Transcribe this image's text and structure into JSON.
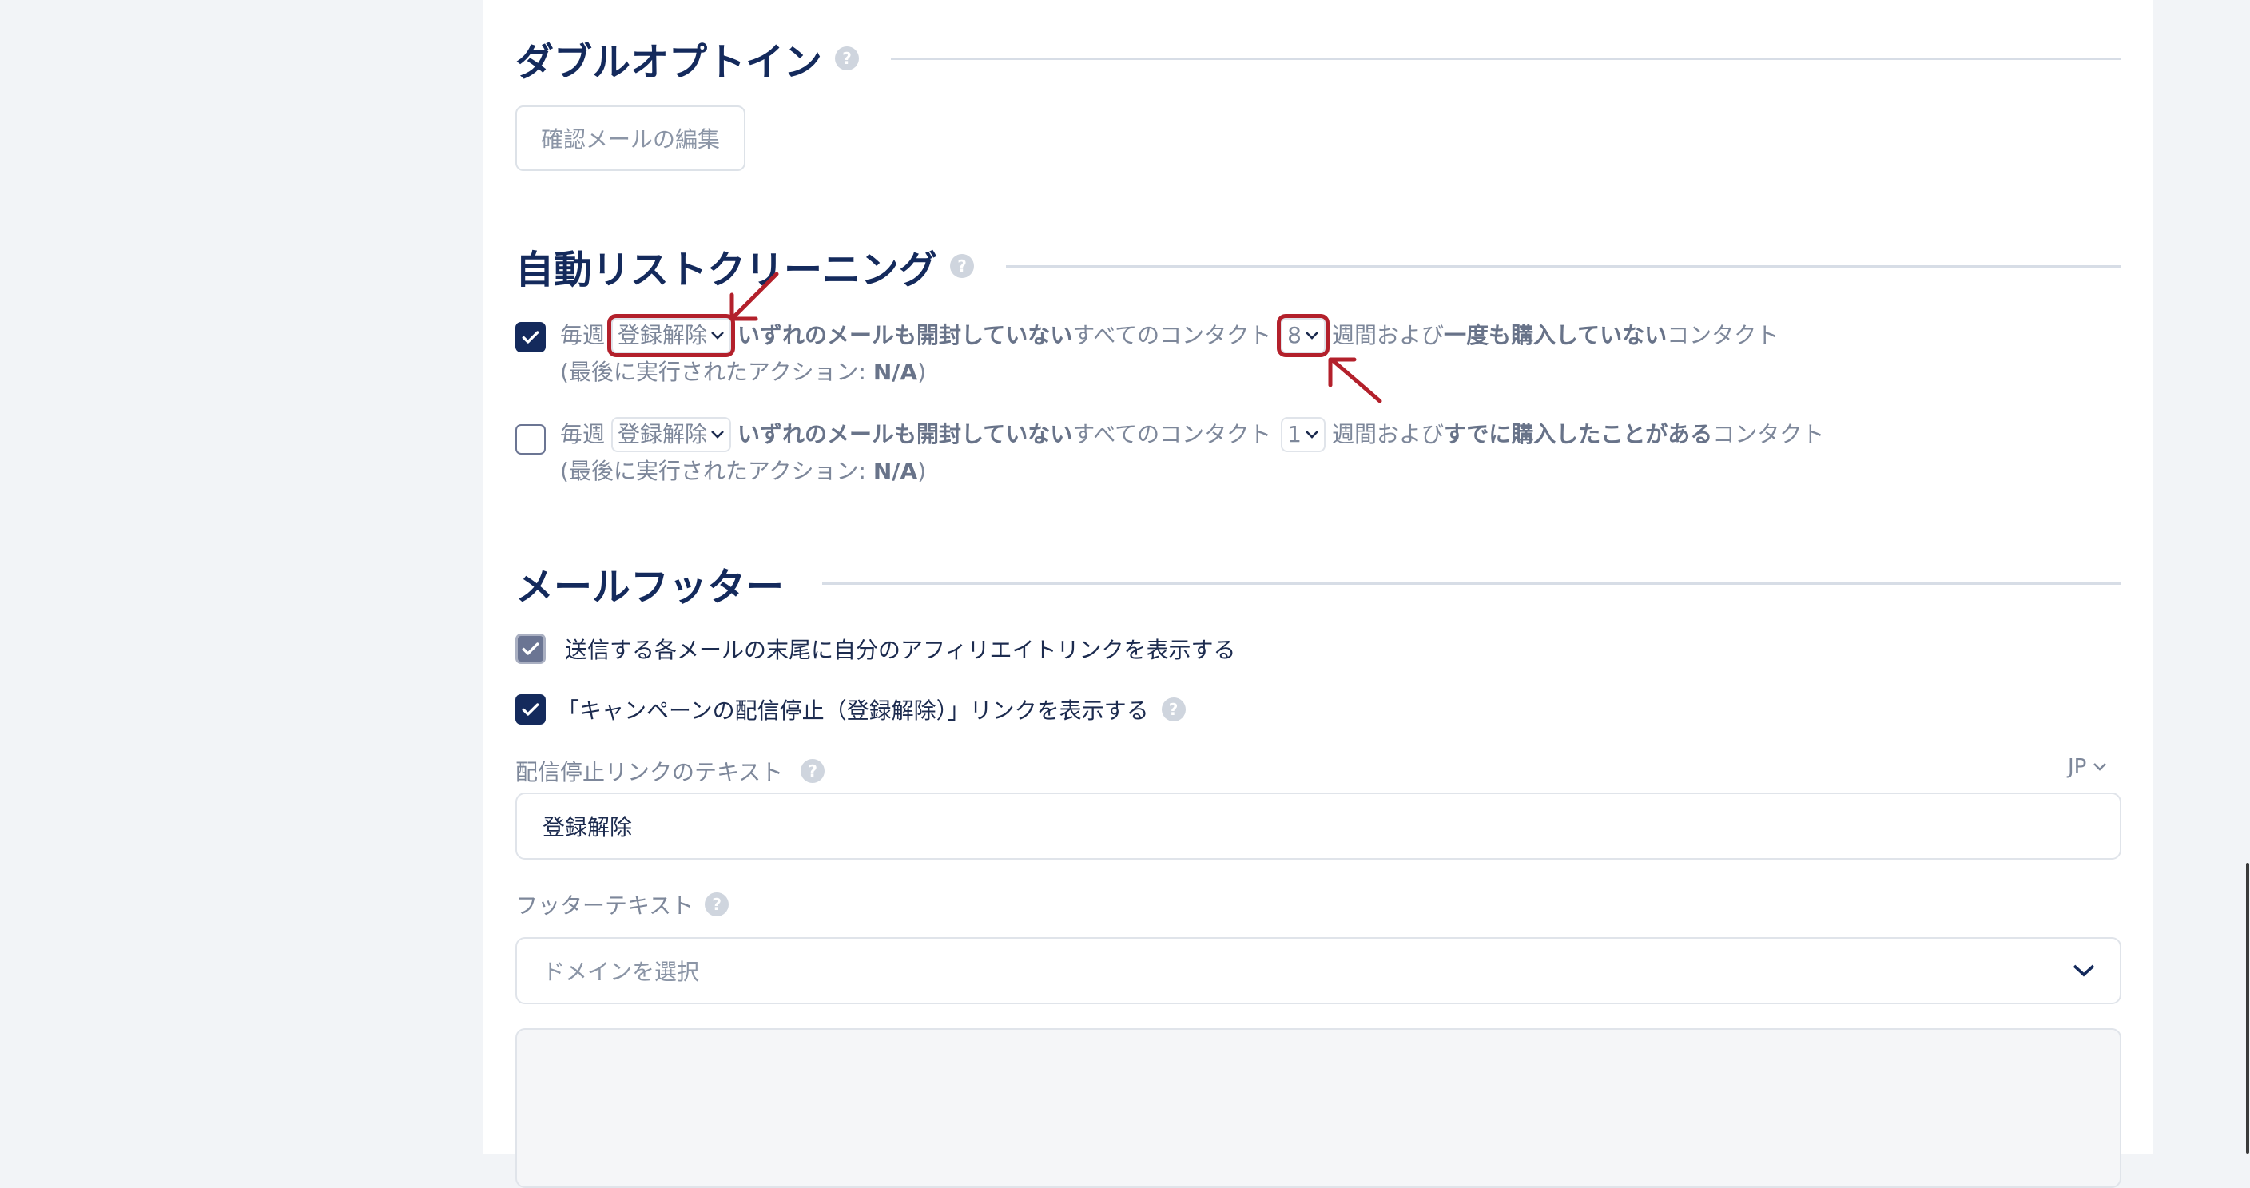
{
  "double_optin": {
    "title": "ダブルオプトイン",
    "help": "?",
    "edit_button": "確認メールの編集"
  },
  "list_cleaning": {
    "title": "自動リストクリーニング",
    "help": "?",
    "rules": [
      {
        "checked": true,
        "prefix": "毎週",
        "action": "登録解除",
        "bold1": "いずれのメールも開封していない",
        "mid": "すべてのコンタクト",
        "weeks": "8",
        "weeks_suffix": "週間および",
        "bold2": "一度も購入していない",
        "suffix": "コンタクト",
        "last_action_label": "(最後に実行されたアクション: ",
        "last_action_value": "N/A",
        "last_action_close": ")"
      },
      {
        "checked": false,
        "prefix": "毎週",
        "action": "登録解除",
        "bold1": "いずれのメールも開封していない",
        "mid": "すべてのコンタクト",
        "weeks": "1",
        "weeks_suffix": "週間および",
        "bold2": "すでに購入したことがある",
        "suffix": "コンタクト",
        "last_action_label": "(最後に実行されたアクション: ",
        "last_action_value": "N/A",
        "last_action_close": ")"
      }
    ]
  },
  "mail_footer": {
    "title": "メールフッター",
    "affiliate_option": "送信する各メールの末尾に自分のアフィリエイトリンクを表示する",
    "unsubscribe_option": "「キャンペーンの配信停止（登録解除）」リンクを表示する",
    "unsubscribe_text_label": "配信停止リンクのテキスト",
    "language": "JP",
    "unsubscribe_text_value": "登録解除",
    "footer_text_label": "フッターテキスト",
    "domain_placeholder": "ドメインを選択",
    "help": "?"
  },
  "colors": {
    "annotation": "#b3202b",
    "navy": "#142a5c"
  }
}
